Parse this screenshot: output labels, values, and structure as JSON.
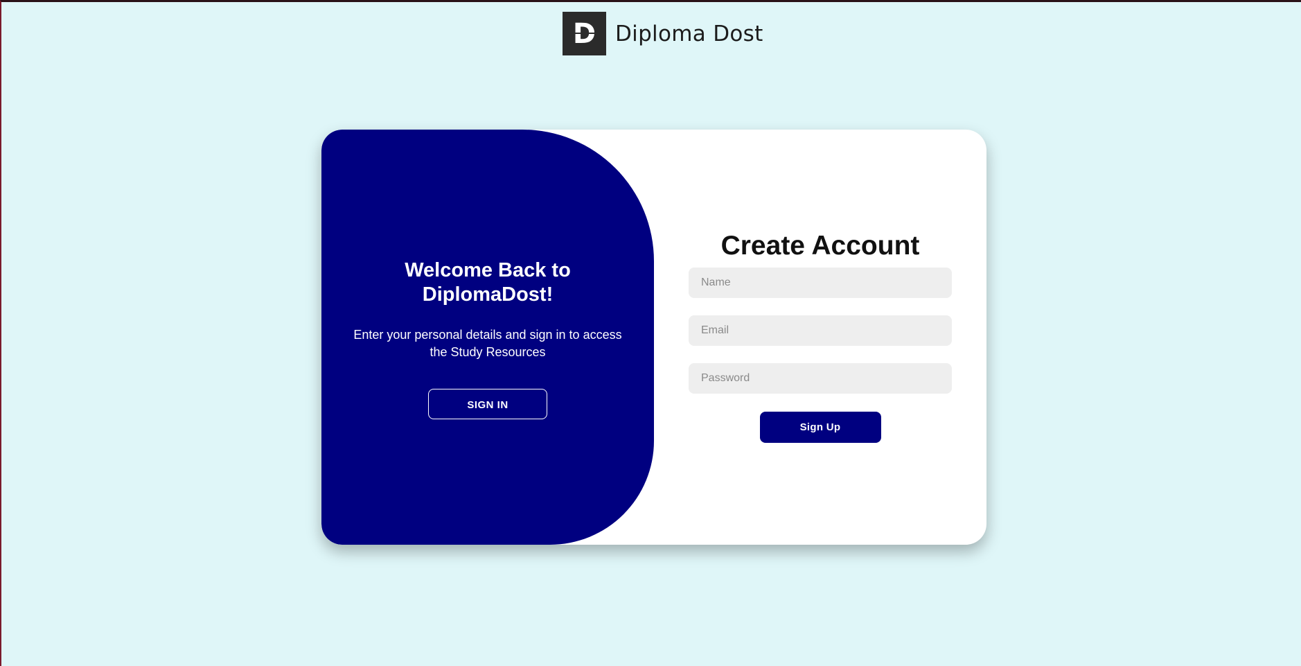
{
  "brand": {
    "logo_letter": "D",
    "name": "Diploma Dost"
  },
  "overlay": {
    "title": "Welcome Back to DiplomaDost!",
    "text": "Enter your personal details and sign in to access the Study Resources",
    "signin_label": "SIGN IN"
  },
  "form": {
    "title": "Create Account",
    "name_placeholder": "Name",
    "email_placeholder": "Email",
    "password_placeholder": "Password",
    "signup_label": "Sign Up"
  },
  "colors": {
    "background": "#dff6f8",
    "accent": "#000080",
    "field_bg": "#eeeeee"
  }
}
